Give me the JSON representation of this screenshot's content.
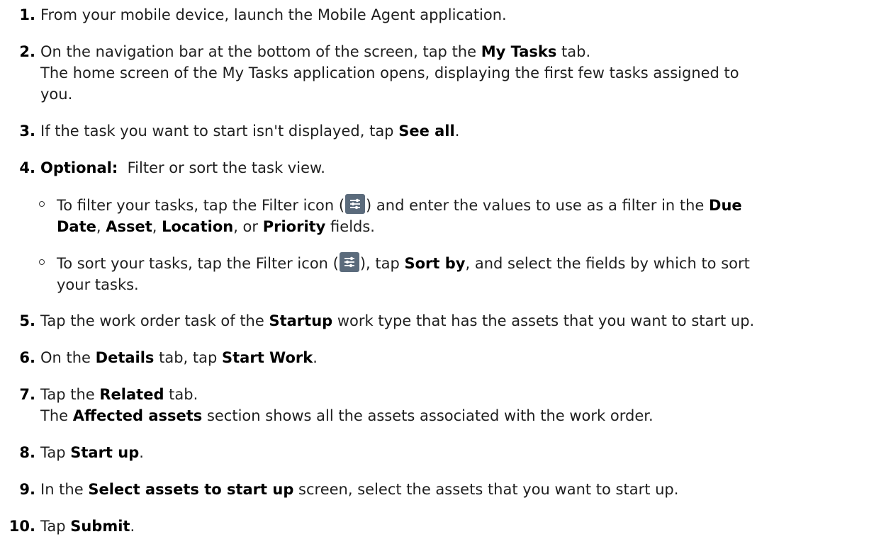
{
  "steps": [
    {
      "num": "1.",
      "text": "From your mobile device, launch the Mobile Agent application."
    },
    {
      "num": "2.",
      "p1": "On the navigation bar at the bottom of the screen, tap the ",
      "b1": "My Tasks",
      "p2": " tab.",
      "l2": "The home screen of the My Tasks application opens, displaying the first few tasks assigned to",
      "l3": "you."
    },
    {
      "num": "3.",
      "p1": "If the task you want to start isn't displayed, tap ",
      "b1": "See all",
      "p2": "."
    },
    {
      "num": "4.",
      "b1": "Optional:",
      "p1": "  Filter or sort the task view."
    },
    {
      "num": "5.",
      "p1": "Tap the work order task of the ",
      "b1": "Startup",
      "p2": " work type that has the assets that you want to start up."
    },
    {
      "num": "6.",
      "p1": "On the ",
      "b1": "Details",
      "p2": " tab, tap ",
      "b2": "Start Work",
      "p3": "."
    },
    {
      "num": "7.",
      "p1": "Tap the ",
      "b1": "Related",
      "p2": " tab.",
      "l2b": "Affected assets",
      "l2p": " section shows all the assets associated with the work order.",
      "l2a": "The "
    },
    {
      "num": "8.",
      "p1": "Tap ",
      "b1": "Start up",
      "p2": "."
    },
    {
      "num": "9.",
      "p1": "In the ",
      "b1": "Select assets to start up",
      "p2": " screen, select the assets that you want to start up."
    },
    {
      "num": "10.",
      "p1": "Tap ",
      "b1": "Submit",
      "p2": "."
    }
  ],
  "sub_filter": {
    "p1": "To filter your tasks, tap the Filter icon (",
    "p2": ") and enter the values to use as a filter in the ",
    "b1": "Due",
    "b2": "Date",
    "p3": ", ",
    "b3": "Asset",
    "p4": ", ",
    "b4": "Location",
    "p5": ", or ",
    "b5": "Priority",
    "p6": " fields."
  },
  "sub_sort": {
    "p1": "To sort your tasks, tap the Filter icon (",
    "p2": "), tap ",
    "b1": "Sort by",
    "p3": ", and select the fields by which to sort",
    "l2": "your tasks."
  },
  "icon": "filter-sliders-icon",
  "colors": {
    "icon_bg": "#5b6b7c",
    "text": "#1f1f1f"
  }
}
